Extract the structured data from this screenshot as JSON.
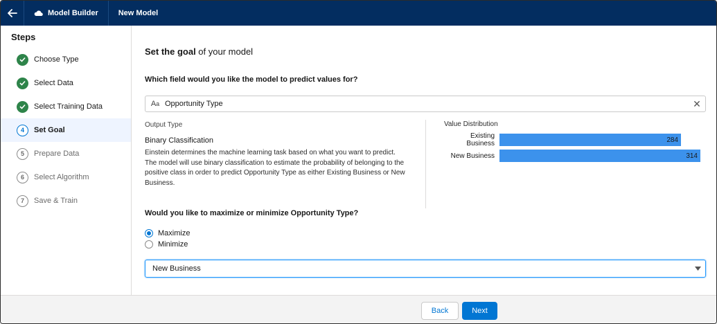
{
  "header": {
    "app_name": "Model Builder",
    "page_title": "New Model"
  },
  "sidebar": {
    "title": "Steps",
    "steps": [
      {
        "num": "1",
        "label": "Choose Type",
        "status": "done"
      },
      {
        "num": "2",
        "label": "Select Data",
        "status": "done"
      },
      {
        "num": "3",
        "label": "Select Training Data",
        "status": "done"
      },
      {
        "num": "4",
        "label": "Set Goal",
        "status": "active"
      },
      {
        "num": "5",
        "label": "Prepare Data",
        "status": "todo"
      },
      {
        "num": "6",
        "label": "Select Algorithm",
        "status": "todo"
      },
      {
        "num": "7",
        "label": "Save & Train",
        "status": "todo"
      }
    ]
  },
  "main": {
    "title_bold": "Set the goal",
    "title_rest": " of your model",
    "question1": "Which field would you like the model to predict values for?",
    "field_icon_text": "Aa",
    "field_value": "Opportunity Type",
    "output_type_label": "Output Type",
    "output_type_value": "Binary Classification",
    "description": "Einstein determines the machine learning task based on what you want to predict. The model will use binary classification to estimate the probability of belonging to the positive class in order to predict Opportunity Type as either Existing Business or New Business.",
    "value_distribution_label": "Value Distribution",
    "distribution": [
      {
        "label": "Existing Business",
        "value": 284,
        "display": "284"
      },
      {
        "label": "New Business",
        "value": 314,
        "display": "314"
      }
    ],
    "question2": "Would you like to maximize or minimize Opportunity Type?",
    "radio_options": [
      {
        "label": "Maximize",
        "checked": true
      },
      {
        "label": "Minimize",
        "checked": false
      }
    ],
    "select_value": "New Business"
  },
  "footer": {
    "back_label": "Back",
    "next_label": "Next"
  },
  "colors": {
    "header_bg": "#032d60",
    "done_green": "#2e844a",
    "brand_blue": "#0176d3",
    "bar_blue": "#3c92ec"
  },
  "icons": {
    "back": "arrow-left-icon",
    "app": "einstein-cloud-icon",
    "done": "checkmark-icon",
    "clear": "close-icon",
    "select": "caret-down-icon"
  }
}
